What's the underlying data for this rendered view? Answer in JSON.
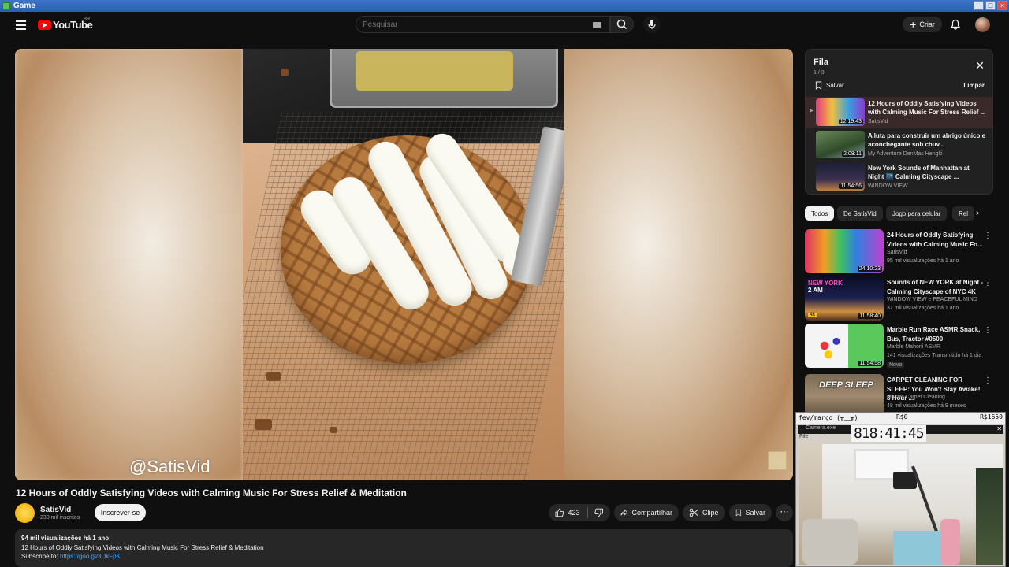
{
  "window": {
    "title": "Game"
  },
  "masthead": {
    "logo_text": "YouTube",
    "country": "BR",
    "search_placeholder": "Pesquisar",
    "create_label": "Criar"
  },
  "video": {
    "watermark": "@SatisVid",
    "title": "12 Hours of Oddly Satisfying Videos with Calming Music For Stress Relief & Meditation",
    "channel": "SatisVid",
    "subscribers": "230 mil inscritos",
    "subscribe_label": "Inscrever-se",
    "likes": "423",
    "share_label": "Compartilhar",
    "clip_label": "Clipe",
    "save_label": "Salvar",
    "more_label": "⋯",
    "description": {
      "stats": "94 mil visualizações  há 1 ano",
      "line1": "12 Hours of Oddly Satisfying Videos with Calming Music For Stress Relief & Meditation",
      "subscribe_prefix": "Subscribe to:",
      "subscribe_link": "https://goo.gl/3DkFpK"
    }
  },
  "queue": {
    "title": "Fila",
    "count": "1 / 3",
    "save_label": "Salvar",
    "clear_label": "Limpar",
    "items": [
      {
        "title": "12 Hours of Oddly Satisfying Videos with Calming Music For Stress Relief ...",
        "channel": "SatisVid",
        "duration": "12:19:43"
      },
      {
        "title": "A luta para construir um abrigo único e aconchegante sob chuv...",
        "channel": "My Adventure DenMas Hengki",
        "duration": "2:08:11"
      },
      {
        "title": "New York Sounds of Manhattan at Night 🌃 Calming Cityscape ...",
        "channel": "WINDOW VIEW",
        "duration": "11:54:56"
      }
    ]
  },
  "chips": [
    "Todos",
    "De SatisVid",
    "Jogo para celular",
    "Rel"
  ],
  "recommendations": [
    {
      "title": "24 Hours of Oddly Satisfying Videos with Calming Music Fo...",
      "channel": "SatisVid",
      "meta": "95 mil visualizações  há 1 ano",
      "duration": "24:10:23",
      "badge": ""
    },
    {
      "title": "Sounds of NEW YORK at Night - Calming Cityscape of NYC 4K",
      "channel": "WINDOW VIEW e PEACEFUL MIND",
      "meta": "37 mil visualizações  há 1 ano",
      "duration": "11:58:40",
      "badge": "",
      "thumb_text1": "NEW YORK",
      "thumb_text2": "2 AM",
      "thumb_badge": "4K"
    },
    {
      "title": "Marble Run Race ASMR Snack, Bus, Tractor #0500",
      "channel": "Marble Mahoni ASMR",
      "meta": "141 visualizações  Transmitido há 1 dia",
      "duration": "11:54:58",
      "badge": "Novo"
    },
    {
      "title": "CARPET CLEANING FOR SLEEP: You Won't Stay Awake! 8 Hour ...",
      "channel": "Master Carpet Cleaning",
      "meta": "48 mil visualizações  há 9 meses",
      "duration": "",
      "badge": "",
      "thumb_text1": "DEEP SLEEP"
    }
  ],
  "overlay": {
    "label_left": "fev/março (╥﹏╥)",
    "label_mid": "R$0",
    "label_right": "R$1650",
    "app_title": "Camera.exe",
    "menu": "File",
    "clock": "818:41:45"
  },
  "colors": {
    "accent_red": "#ff0000",
    "link_blue": "#3ea6ff",
    "bg": "#0f0f0f"
  }
}
